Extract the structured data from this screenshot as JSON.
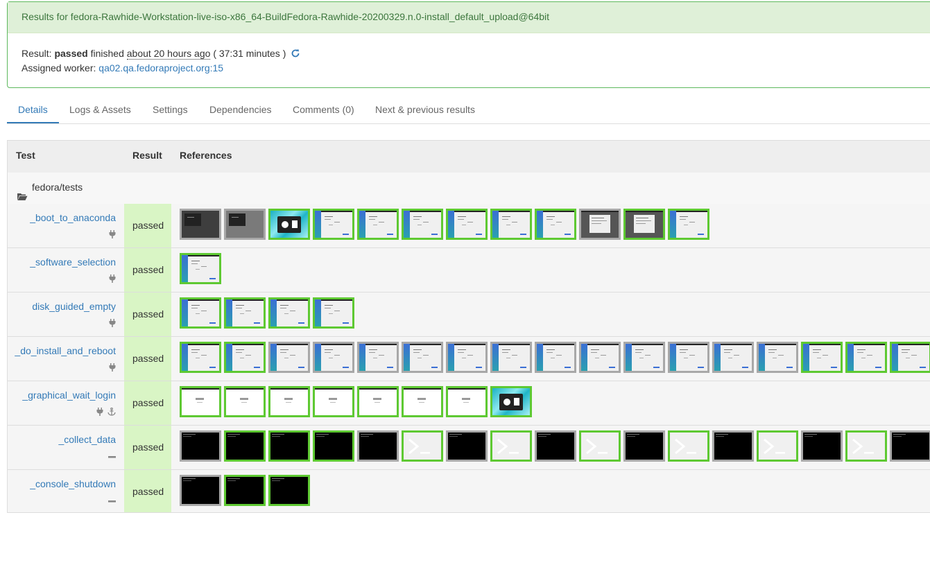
{
  "header": {
    "title": "Results for fedora-Rawhide-Workstation-live-iso-x86_64-BuildFedora-Rawhide-20200329.n.0-install_default_upload@64bit",
    "result_label": "Result:",
    "result_value": "passed",
    "finished_label": "finished",
    "finished_ago": "about 20 hours ago",
    "duration": "( 37:31 minutes )",
    "worker_label": "Assigned worker:",
    "worker_host": "qa02.qa.fedoraproject.org",
    "worker_slot": ":15"
  },
  "tabs": [
    "Details",
    "Logs & Assets",
    "Settings",
    "Dependencies",
    "Comments (0)",
    "Next & previous results"
  ],
  "table": {
    "headers": {
      "test": "Test",
      "result": "Result",
      "references": "References"
    },
    "group": "fedora/tests",
    "rows": [
      {
        "name": "_boot_to_anaconda",
        "result": "passed",
        "icons": [
          "plug-icon"
        ],
        "thumbs": [
          [
            "dark",
            "n"
          ],
          [
            "gray",
            "n"
          ],
          [
            "cyan",
            "g"
          ],
          [
            "ana",
            "g"
          ],
          [
            "ana",
            "g"
          ],
          [
            "ana",
            "g"
          ],
          [
            "ana",
            "g"
          ],
          [
            "ana",
            "g"
          ],
          [
            "ana",
            "g"
          ],
          [
            "dlg",
            "n"
          ],
          [
            "dlg",
            "g"
          ],
          [
            "ana",
            "g"
          ]
        ]
      },
      {
        "name": "_software_selection",
        "result": "passed",
        "icons": [
          "plug-icon"
        ],
        "thumbs": [
          [
            "ana",
            "g"
          ]
        ]
      },
      {
        "name": "disk_guided_empty",
        "result": "passed",
        "icons": [
          "plug-icon"
        ],
        "thumbs": [
          [
            "ana",
            "g"
          ],
          [
            "ana",
            "g"
          ],
          [
            "ana",
            "g"
          ],
          [
            "ana",
            "g"
          ]
        ]
      },
      {
        "name": "_do_install_and_reboot",
        "result": "passed",
        "icons": [
          "plug-icon"
        ],
        "thumbs": [
          [
            "ana",
            "g"
          ],
          [
            "ana",
            "g"
          ],
          [
            "ana",
            "n"
          ],
          [
            "ana",
            "n"
          ],
          [
            "ana",
            "n"
          ],
          [
            "ana",
            "n"
          ],
          [
            "ana",
            "n"
          ],
          [
            "ana",
            "n"
          ],
          [
            "ana",
            "n"
          ],
          [
            "ana",
            "n"
          ],
          [
            "ana",
            "n"
          ],
          [
            "ana",
            "n"
          ],
          [
            "ana",
            "n"
          ],
          [
            "ana",
            "n"
          ],
          [
            "ana",
            "g"
          ],
          [
            "ana",
            "g"
          ],
          [
            "ana",
            "g"
          ]
        ]
      },
      {
        "name": "_graphical_wait_login",
        "result": "passed",
        "icons": [
          "plug-icon",
          "anchor-icon"
        ],
        "thumbs": [
          [
            "white",
            "g"
          ],
          [
            "white",
            "g"
          ],
          [
            "white",
            "g"
          ],
          [
            "white",
            "g"
          ],
          [
            "white",
            "g"
          ],
          [
            "white",
            "g"
          ],
          [
            "white",
            "g"
          ],
          [
            "cyan",
            "g"
          ]
        ]
      },
      {
        "name": "_collect_data",
        "result": "passed",
        "icons": [
          "minus-icon"
        ],
        "thumbs": [
          [
            "black",
            "n"
          ],
          [
            "black",
            "g"
          ],
          [
            "black",
            "g"
          ],
          [
            "black",
            "g"
          ],
          [
            "black",
            "n"
          ],
          [
            "term",
            "g"
          ],
          [
            "black",
            "n"
          ],
          [
            "term",
            "g"
          ],
          [
            "black",
            "n"
          ],
          [
            "term",
            "g"
          ],
          [
            "black",
            "n"
          ],
          [
            "term",
            "g"
          ],
          [
            "black",
            "n"
          ],
          [
            "term",
            "g"
          ],
          [
            "black",
            "n"
          ],
          [
            "term",
            "g"
          ],
          [
            "black",
            "n"
          ]
        ]
      },
      {
        "name": "_console_shutdown",
        "result": "passed",
        "icons": [
          "minus-icon"
        ],
        "thumbs": [
          [
            "black",
            "n"
          ],
          [
            "black",
            "g"
          ],
          [
            "black",
            "g"
          ]
        ]
      }
    ]
  },
  "colors": {
    "success_border": "#5cb85c",
    "result_cell": "#d9f5c5",
    "thumb_match": "#5ec932",
    "thumb_neutral": "#a8a8a8",
    "link": "#337ab7"
  }
}
